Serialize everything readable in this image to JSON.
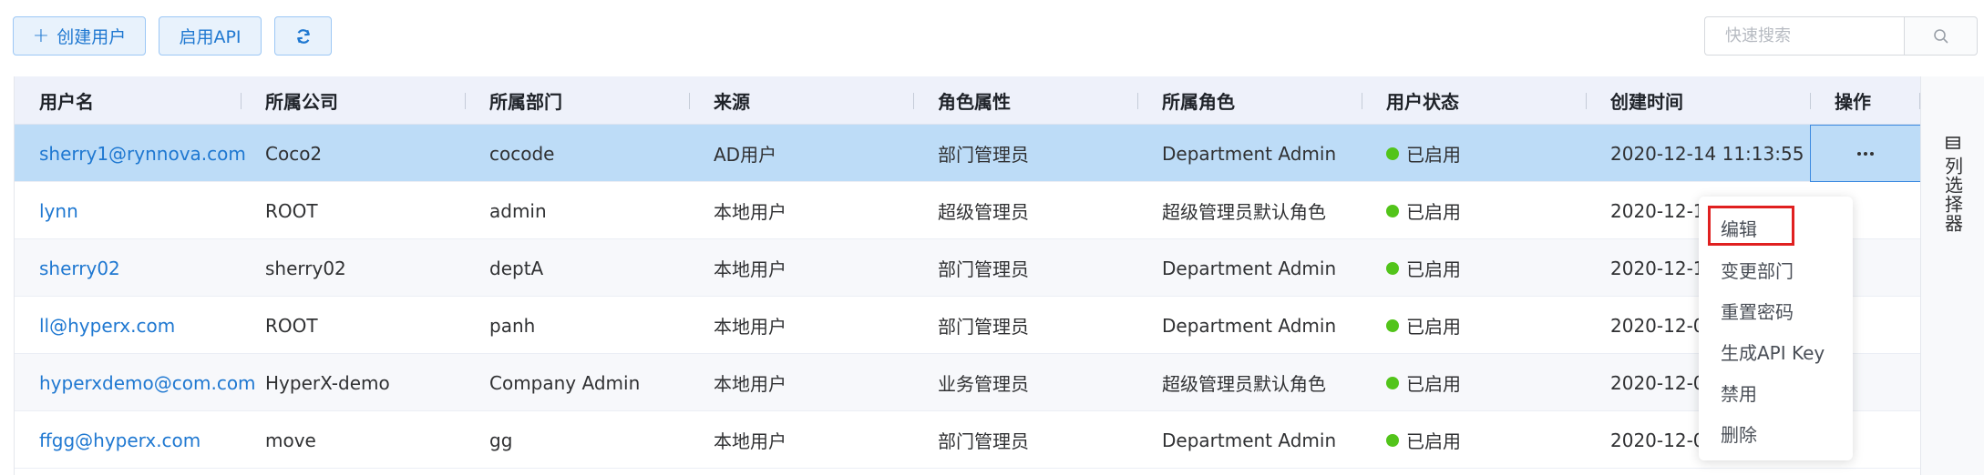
{
  "toolbar": {
    "create_label": "创建用户",
    "api_label": "启用API",
    "search_placeholder": "快速搜索"
  },
  "table": {
    "headers": [
      "用户名",
      "所属公司",
      "所属部门",
      "来源",
      "角色属性",
      "所属角色",
      "用户状态",
      "创建时间",
      "操作"
    ],
    "rows": [
      {
        "username": "sherry1@rynnova.com",
        "company": "Coco2",
        "department": "cocode",
        "source": "AD用户",
        "role_attr": "部门管理员",
        "role": "Department Admin",
        "status": "已启用",
        "created": "2020-12-14 11:13:55"
      },
      {
        "username": "lynn",
        "company": "ROOT",
        "department": "admin",
        "source": "本地用户",
        "role_attr": "超级管理员",
        "role": "超级管理员默认角色",
        "status": "已启用",
        "created": "2020-12-1"
      },
      {
        "username": "sherry02",
        "company": "sherry02",
        "department": "deptA",
        "source": "本地用户",
        "role_attr": "部门管理员",
        "role": "Department Admin",
        "status": "已启用",
        "created": "2020-12-1"
      },
      {
        "username": "ll@hyperx.com",
        "company": "ROOT",
        "department": "panh",
        "source": "本地用户",
        "role_attr": "部门管理员",
        "role": "Department Admin",
        "status": "已启用",
        "created": "2020-12-0"
      },
      {
        "username": "hyperxdemo@com.com",
        "company": "HyperX-demo",
        "department": "Company Admin",
        "source": "本地用户",
        "role_attr": "业务管理员",
        "role": "超级管理员默认角色",
        "status": "已启用",
        "created": "2020-12-0"
      },
      {
        "username": "ffgg@hyperx.com",
        "company": "move",
        "department": "gg",
        "source": "本地用户",
        "role_attr": "部门管理员",
        "role": "Department Admin",
        "status": "已启用",
        "created": "2020-12-0"
      }
    ],
    "status_color": "#52c41a"
  },
  "column_chooser": {
    "label": "列选择器"
  },
  "action_menu": {
    "items": [
      "编辑",
      "变更部门",
      "重置密码",
      "生成API Key",
      "禁用",
      "删除"
    ],
    "highlight_color": "#e02020"
  },
  "colors": {
    "accent": "#1f78d1",
    "selected_row": "#bddcf7",
    "header_bg": "#eef1fa"
  }
}
